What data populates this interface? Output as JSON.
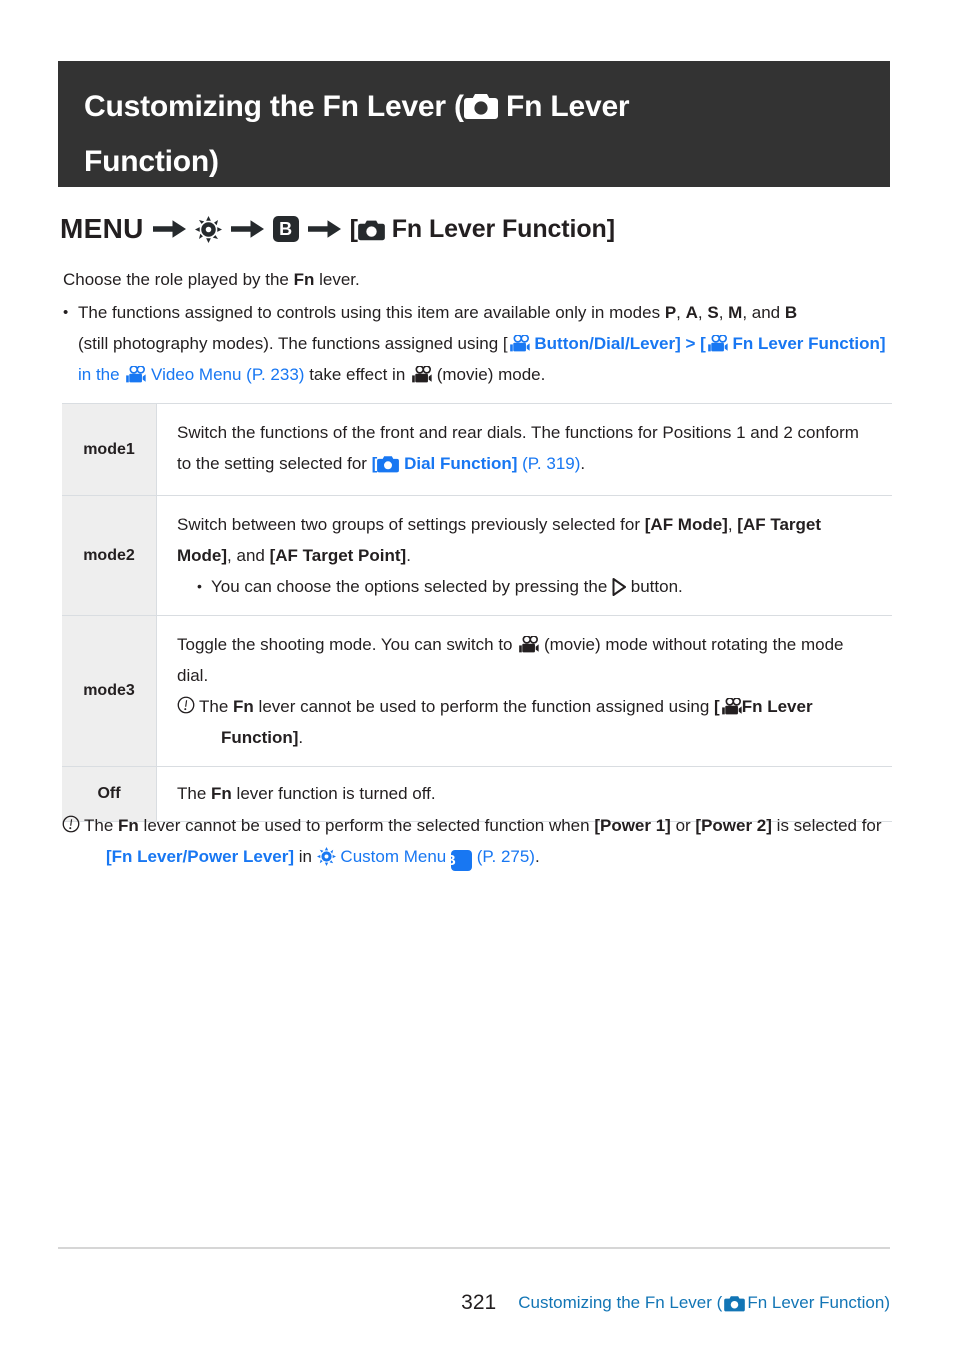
{
  "title": {
    "line1_pre": "Customizing the Fn Lever (",
    "icon": "camera-icon",
    "line1_post": " Fn Lever",
    "line2": "Function)"
  },
  "breadcrumb": {
    "menu": "MENU",
    "arrow": "arrow-right-icon",
    "gear": "gear-icon",
    "boxed_b": "B",
    "target_open": "[",
    "target_icon": "camera-icon",
    "target_label": "Fn Lever Function]"
  },
  "intro": {
    "line_pre": "Choose the role played by the ",
    "line_bold": "Fn",
    "line_post": " lever."
  },
  "bullet": {
    "dot": "•",
    "seg1": "The functions assigned to controls using this item are available only in modes ",
    "modes": [
      "P",
      "A",
      "S",
      "M",
      "B"
    ],
    "mode_sep": ", ",
    "mode_and": ", and ",
    "seg2": "(still photography modes). The functions assigned using [",
    "movie_icon": "movie-camera-icon",
    "link1": " Button/Dial/Lever]",
    "gt": " > ",
    "bracket": "[",
    "link2": " Fn Lever Function]",
    "seg3": " in the ",
    "link3": " Video Menu (P. 233)",
    "seg4": " take effect in ",
    "seg5": " (movie) mode."
  },
  "table": {
    "rows": [
      {
        "label": "mode1",
        "text_a": "Switch the functions of the front and rear dials. The functions for Positions 1 and 2 conform to the setting selected for ",
        "link_open": "[",
        "link_icon": "camera-icon-blue",
        "link_text": " Dial Function]",
        "page_ref": " (P. 319)",
        "text_b": "."
      },
      {
        "label": "mode2",
        "text_a": "Switch between two groups of settings previously selected for ",
        "bold1": "[AF Mode]",
        "sep1": ", ",
        "bold2": "[AF Target Mode]",
        "sep2": ", and ",
        "bold3": "[AF Target Point]",
        "sep3": ".",
        "sub_dot": "•",
        "sub_text_a": "You can choose the options selected by pressing the ",
        "sub_icon": "triangle-right-icon",
        "sub_text_b": " button."
      },
      {
        "label": "mode3",
        "text_a": "Toggle the shooting mode. You can switch to ",
        "movie_icon": "movie-camera-icon",
        "text_b": " (movie) mode without rotating the mode dial.",
        "note_icon": "info-exclamation-icon",
        "note_pre": "The ",
        "note_bold": "Fn",
        "note_mid": " lever cannot be used to perform the function assigned using ",
        "note_link_open": "[",
        "note_link_icon": "movie-camera-icon",
        "note_link_text": "Fn Lever Function]",
        "note_end": "."
      },
      {
        "label": "Off",
        "text_a": "The ",
        "bold1": "Fn",
        "text_b": " lever function is turned off."
      }
    ]
  },
  "bottom_note": {
    "icon": "info-exclamation-icon",
    "pre": "The ",
    "bold1": "Fn",
    "mid": " lever cannot be used to perform the selected function when ",
    "bold2": "[Power 1]",
    "or": " or ",
    "bold3": "[Power 2]",
    "mid2": " is selected for ",
    "link1": "[Fn Lever/Power Lever]",
    "mid3": " in ",
    "gear_icon": "gear-icon-blue",
    "link2": " Custom Menu ",
    "boxed_b": "B",
    "page_ref": " (P. 275)",
    "end": "."
  },
  "footer": {
    "page_number": "321",
    "link_pre": "Customizing the Fn Lever (",
    "link_icon": "camera-icon-blue",
    "link_post": " Fn Lever Function)"
  },
  "colors": {
    "banner_bg": "#333333",
    "link_blue": "#1877f2",
    "footer_blue": "#1275b5",
    "table_label_bg": "#eeeeee",
    "rule": "#d6d6d6",
    "text": "#231f20"
  }
}
